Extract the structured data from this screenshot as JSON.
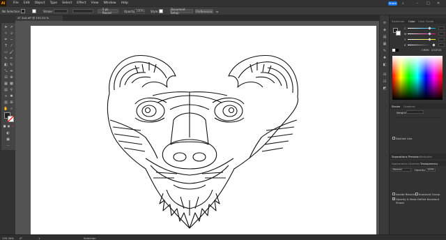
{
  "app": {
    "logo": "Ai"
  },
  "menu": {
    "items": [
      "File",
      "Edit",
      "Object",
      "Type",
      "Select",
      "Effect",
      "View",
      "Window",
      "Help"
    ],
    "share": "Share"
  },
  "control_bar": {
    "selection": "No Selection",
    "stroke_label": "Stroke:",
    "brush": "5 pt. Round",
    "opacity_label": "Opacity:",
    "opacity_value": "100%",
    "style_label": "Style:",
    "doc_setup": "Document Setup",
    "preferences": "Preferences"
  },
  "document_tab": {
    "title": "4T 4x4.ai* @ 155.34 % (RGB/Preview)"
  },
  "panels": {
    "top_tabs": [
      "Swatches",
      "Color",
      "Color Guide"
    ],
    "color_mode": "CMYK",
    "hex_value": "231F20",
    "stroke_tabs": [
      "Stroke",
      "Gradient"
    ],
    "weight_label": "Weight:",
    "dashed_line": "Dashed Line",
    "sep_tabs": [
      "Separations Preview",
      "Attributes"
    ],
    "appearance_tabs": [
      "Appearance",
      "Libraries",
      "Transparency"
    ],
    "blend_mode": "Normal",
    "opacity_label": "Opacity:",
    "opacity_value": "100%",
    "isolate_blending": "Isolate Blending",
    "knockout_group": "Knockout Group",
    "opacity_mask": "Opacity & Mask Define Knockout Shape"
  },
  "status": {
    "zoom": "155.34%",
    "rotate": "0°",
    "page": "1",
    "tool": "Selection"
  },
  "colors": {
    "accent": "#1473e6",
    "fill": "#231f20",
    "stroke_none": "#ffffff",
    "brand": "#ff9a00"
  },
  "icons": [
    "selection-arrow-icon",
    "pen-icon",
    "type-icon",
    "brush-icon",
    "zoom-icon",
    "hand-icon"
  ]
}
